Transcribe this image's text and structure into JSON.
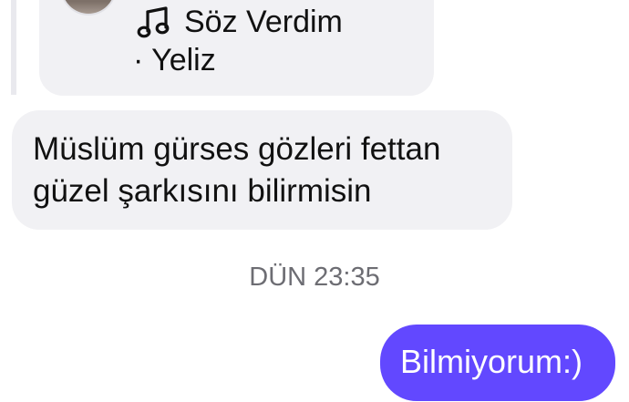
{
  "conversation": {
    "shared_song": {
      "title": "Söz Verdim",
      "artist": "· Yeliz",
      "icon": "music-note-icon"
    },
    "incoming_message": {
      "text": "Müslüm gürses gözleri fettan güzel şarkısını bilirmisin"
    },
    "timestamp": "DÜN 23:35",
    "outgoing_message": {
      "text": "Bilmiyorum:)"
    }
  },
  "colors": {
    "incoming_bubble": "#f1f1f4",
    "outgoing_bubble": "#6248ff",
    "timestamp_text": "#6d6d73",
    "page_background": "#ffffff"
  }
}
